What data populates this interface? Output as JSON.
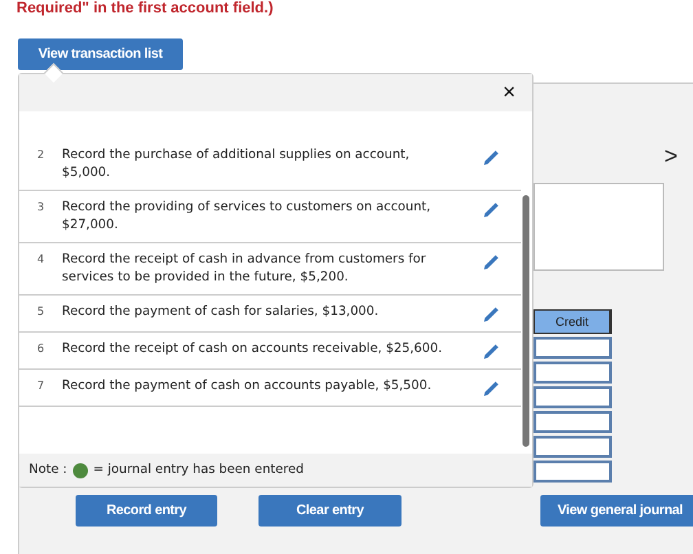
{
  "instruction": "Required\" in the first account field.)",
  "view_list_button": "View transaction list",
  "popup": {
    "close": "×",
    "transactions": [
      {
        "number": "2",
        "text": "Record the purchase of additional supplies on account, $5,000."
      },
      {
        "number": "3",
        "text": "Record the providing of services to customers on account, $27,000."
      },
      {
        "number": "4",
        "text": "Record the receipt of cash in advance from customers for services to be provided in the future, $5,200."
      },
      {
        "number": "5",
        "text": "Record the payment of cash for salaries, $13,000."
      },
      {
        "number": "6",
        "text": "Record the receipt of cash on accounts receivable, $25,600."
      },
      {
        "number": "7",
        "text": "Record the payment of cash on accounts payable, $5,500."
      }
    ],
    "note": {
      "label": "Note :",
      "text": "= journal entry has been entered"
    }
  },
  "next": ">",
  "credit_table": {
    "header": "Credit",
    "fields": [
      {
        "kind": "amount"
      },
      {
        "kind": "amount"
      },
      {
        "kind": "amount"
      },
      {
        "kind": "amount"
      },
      {
        "kind": "amount"
      },
      {
        "kind": "amount"
      }
    ]
  },
  "buttons": [
    "Record entry",
    "Clear entry",
    "View general journal"
  ]
}
